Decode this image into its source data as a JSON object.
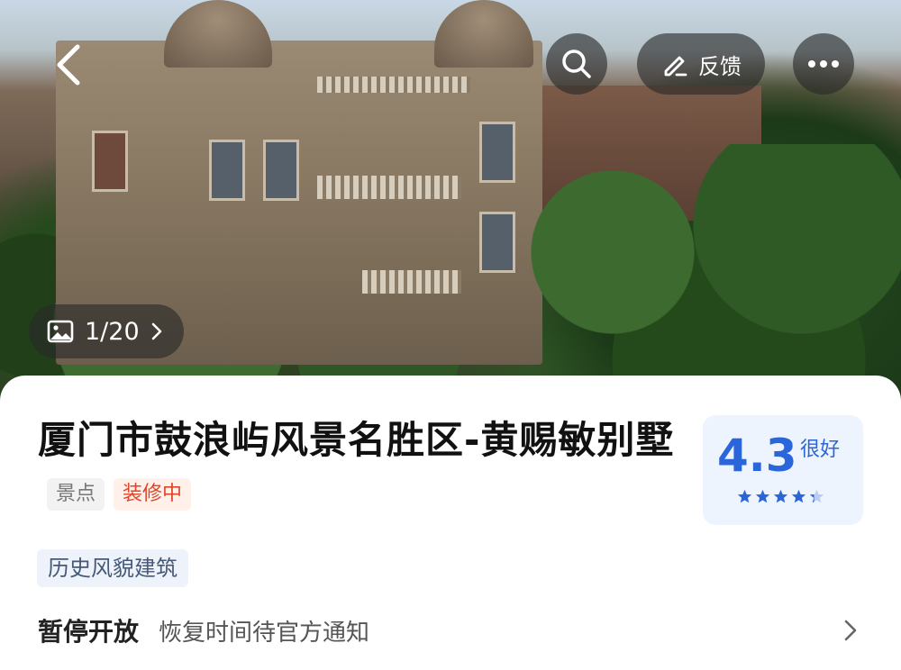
{
  "photo_overlay": {
    "counter": "1/20",
    "feedback_label": "反馈"
  },
  "place": {
    "name": "厦门市鼓浪屿风景名胜区-黄赐敏别墅",
    "type_tag": "景点",
    "status_tag": "装修中",
    "category": "历史风貌建筑"
  },
  "rating": {
    "score": "4.3",
    "label": "很好",
    "stars": 4.3,
    "star_color": "#2a66d9"
  },
  "status": {
    "main": "暂停开放",
    "detail": "恢复时间待官方通知"
  }
}
